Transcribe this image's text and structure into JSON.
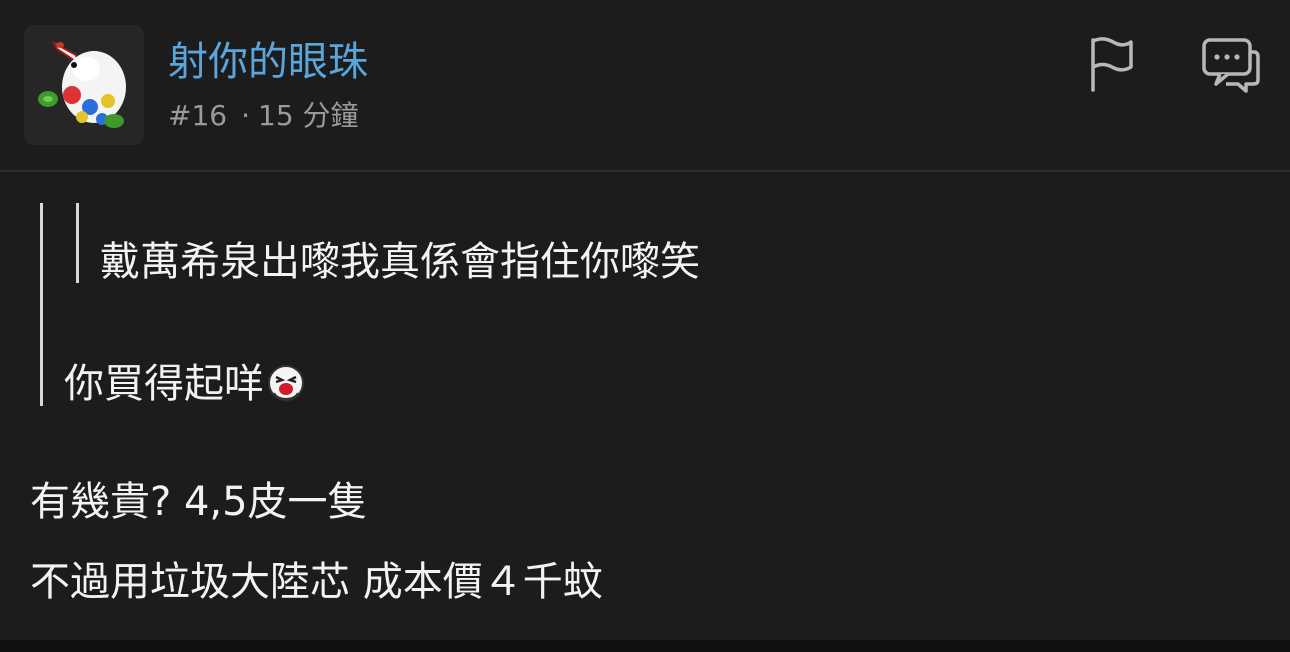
{
  "post": {
    "username": "射你的眼珠",
    "post_number": "#16",
    "separator": "·",
    "time_ago": "15 分鐘",
    "avatar_icon": "kiwi-bird-avatar-icon",
    "actions": {
      "report_icon": "flag-icon",
      "reply_icon": "comment-bubble-icon"
    },
    "quote": {
      "nested_text": "戴萬希泉出嚟我真係會指住你嚟笑",
      "text": "你買得起咩",
      "emoji_icon": "laughing-face-emoji-icon"
    },
    "body_lines": [
      "有幾貴? 4,5皮一隻",
      "不過用垃圾大陸芯 成本價４千蚊"
    ]
  },
  "colors": {
    "background": "#1c1c1c",
    "username": "#5aa5dc",
    "meta": "#9a9a9a",
    "text": "#f2f2f2",
    "quote_bar": "#d8d8d8"
  }
}
